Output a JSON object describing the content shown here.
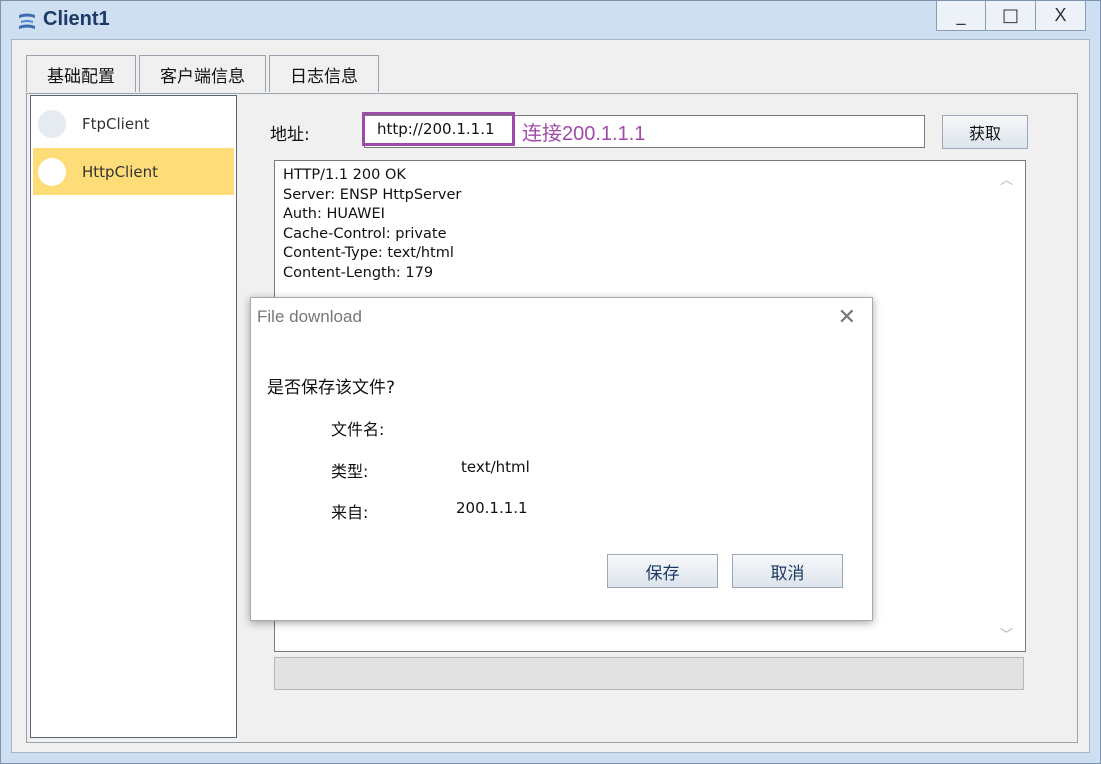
{
  "window": {
    "title": "Client1",
    "minimize": "_",
    "maximize": "□",
    "close": "X"
  },
  "tabs": [
    {
      "label": "基础配置"
    },
    {
      "label": "客户端信息"
    },
    {
      "label": "日志信息"
    }
  ],
  "sidebar": {
    "items": [
      {
        "label": "FtpClient"
      },
      {
        "label": "HttpClient"
      }
    ],
    "selected": "HttpClient"
  },
  "address": {
    "label": "地址:",
    "value": "http://200.1.1.1",
    "annotation": "连接200.1.1.1",
    "annotation_color": "#a24aa9",
    "fetch_button": "获取"
  },
  "response": {
    "lines": [
      "HTTP/1.1 200 OK",
      "Server: ENSP HttpServer",
      "Auth: HUAWEI",
      "Cache-Control: private",
      "Content-Type: text/html",
      "Content-Length: 179"
    ]
  },
  "dialog": {
    "title": "File download",
    "question": "是否保存该文件?",
    "filename_label": "文件名:",
    "filename_value": "",
    "type_label": "类型:",
    "type_value": "text/html",
    "from_label": "来自:",
    "from_value": "200.1.1.1",
    "save_button": "保存",
    "cancel_button": "取消"
  },
  "colors": {
    "selected_item": "#fedc78",
    "window_frame": "#cfdff2"
  }
}
